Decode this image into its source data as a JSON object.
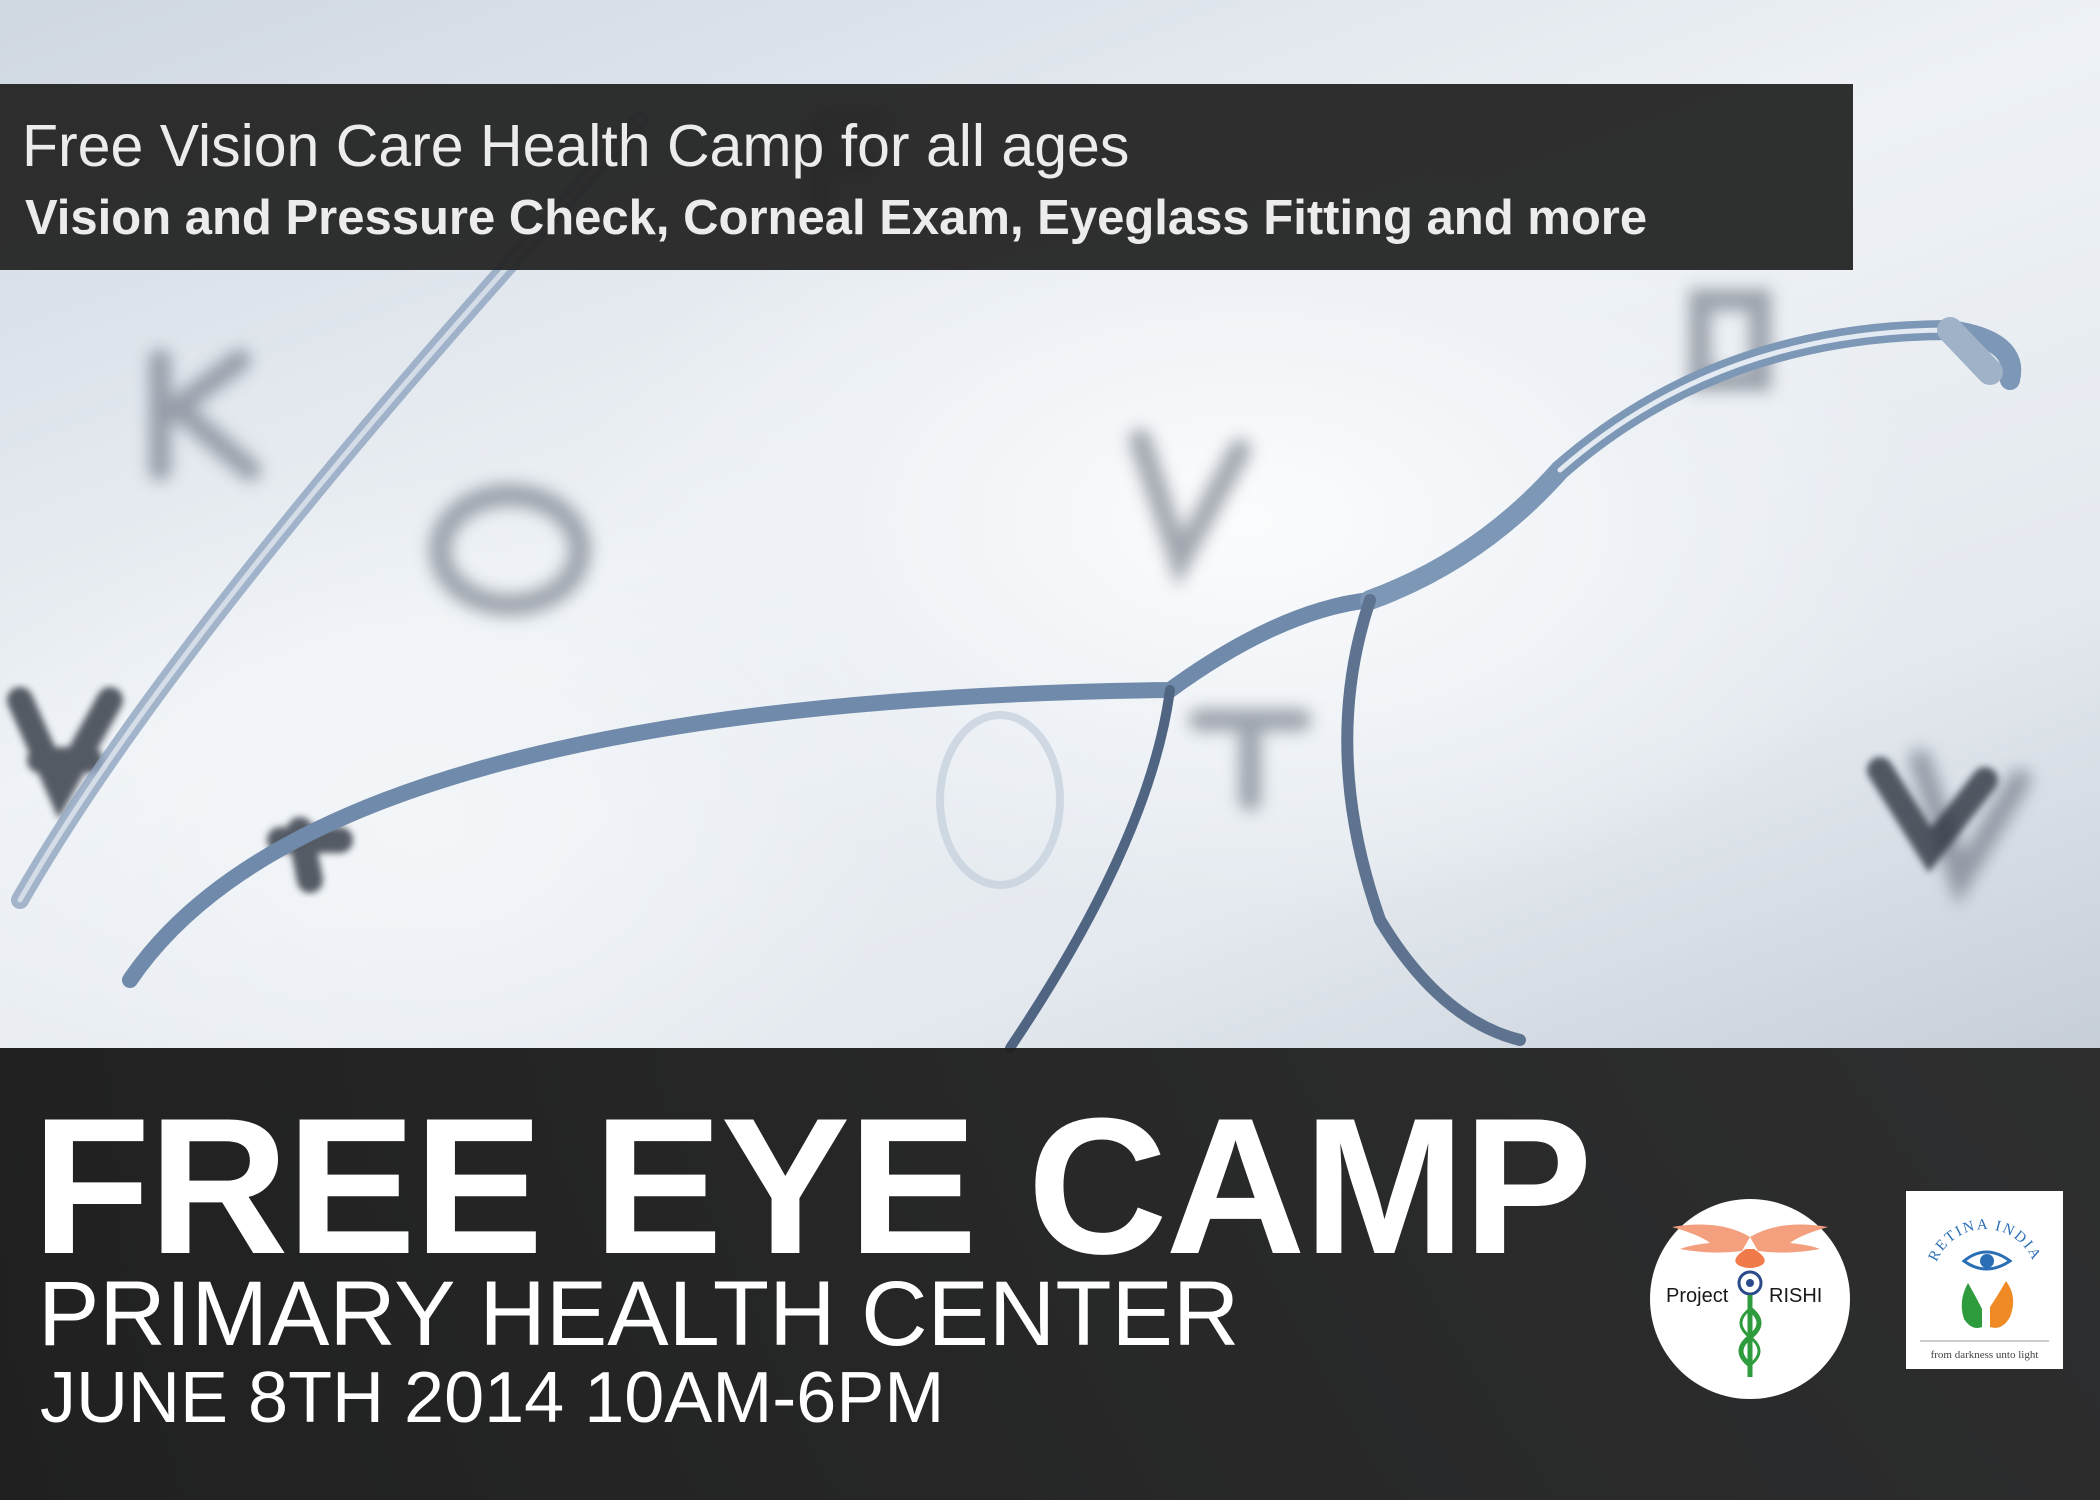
{
  "banner": {
    "line1": "Free Vision Care Health Camp for all ages",
    "line2": "Vision and Pressure Check, Corneal Exam, Eyeglass Fitting and more"
  },
  "event": {
    "headline": "FREE EYE CAMP",
    "venue": "PRIMARY HEALTH CENTER",
    "datetime": "JUNE 8TH 2014 10AM-6PM"
  },
  "logos": {
    "project_rishi": {
      "word1": "Project",
      "word2": "RISHI",
      "icon": "caduceus-icon"
    },
    "retina_india": {
      "arc_text": "RETINA INDIA",
      "tagline": "from darkness unto light",
      "icon": "eye-hand-icon"
    }
  },
  "colors": {
    "banner_bg": "#222222",
    "text": "#ffffff",
    "caduceus": "#f07a4a",
    "flag_green": "#2e9b3c",
    "flag_orange": "#f08a24",
    "eye_blue": "#2a6fb5"
  }
}
